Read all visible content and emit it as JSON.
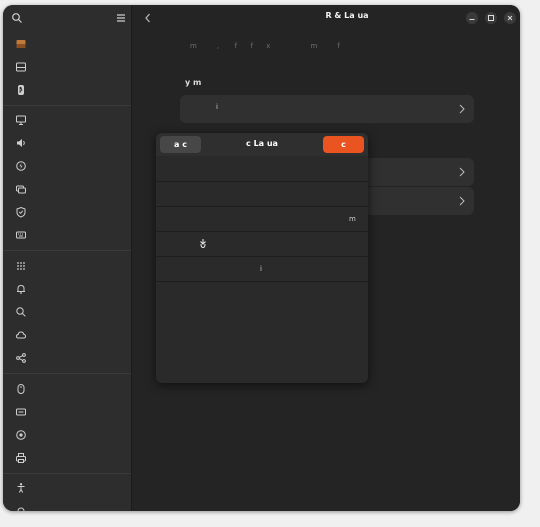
{
  "window": {
    "title": "R     & La     ua"
  },
  "content": {
    "faded_header": "m         ,       f      f      x                  m         f",
    "section_heading": "y    m",
    "row1_label": "i"
  },
  "dialog": {
    "cancel_label": "a  c",
    "title": "c  La     ua",
    "ok_label": "c",
    "row3_text": "m",
    "row5_text": "i"
  },
  "colors": {
    "accent": "#e95420",
    "window_bg": "#242424",
    "sidebar_bg": "#2d2d2d",
    "dialog_bg": "#2a2a2a"
  },
  "icons": {
    "sidebar_header": [
      "search-icon",
      "menu-icon"
    ],
    "sidebar_groups": [
      [
        "wallpaper-icon",
        "panel-icon",
        "bluetooth-icon"
      ],
      [
        "display-icon",
        "sound-icon",
        "power-icon",
        "multitasking-icon",
        "security-icon",
        "keyboard-icon"
      ],
      [
        "apps-icon",
        "notifications-icon",
        "search-icon",
        "cloud-icon",
        "share-icon"
      ],
      [
        "mouse-icon",
        "keyboard-layout-icon",
        "color-icon",
        "printer-icon"
      ],
      [
        "accessibility-icon",
        "system-icon"
      ]
    ],
    "window_controls": [
      "minimize-icon",
      "maximize-icon",
      "close-icon"
    ]
  }
}
